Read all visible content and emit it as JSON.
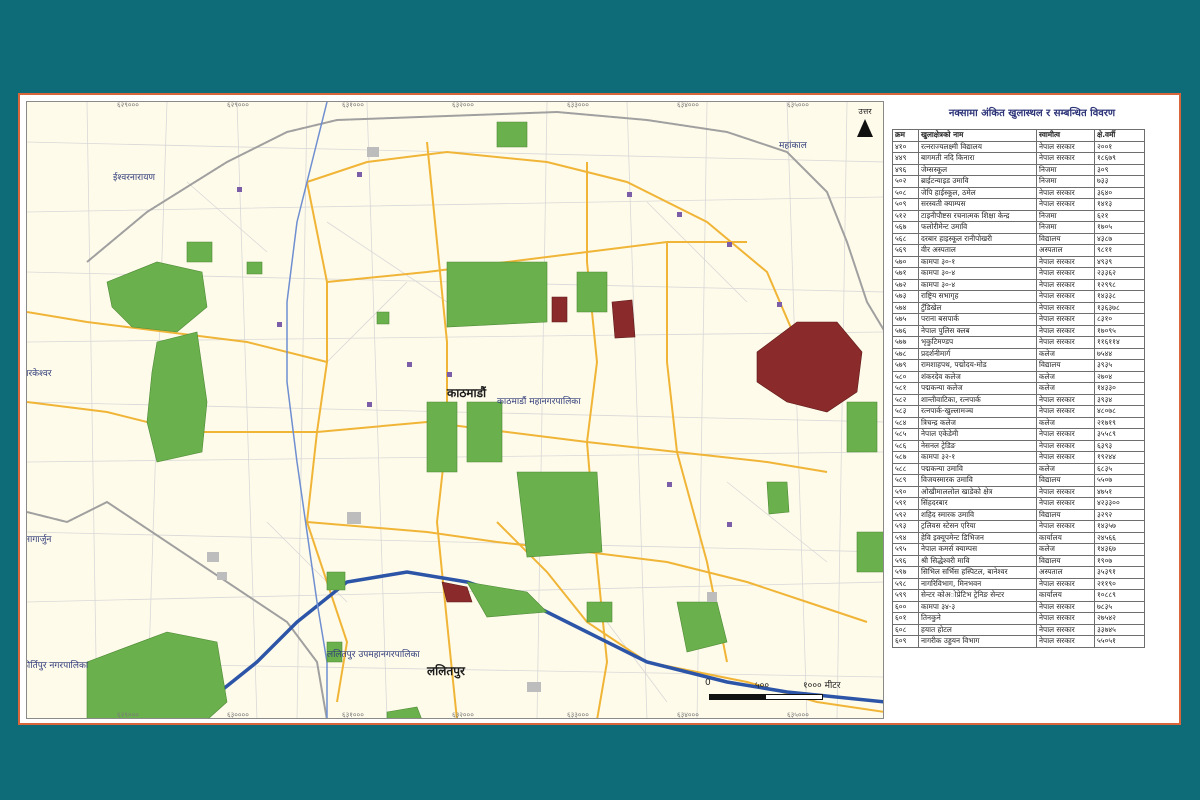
{
  "map": {
    "place_labels": [
      {
        "id": "kathmandu",
        "text": "काठमाडौं"
      },
      {
        "id": "kathmandu-metro",
        "text": "काठमाडौं महानगरपालिका"
      },
      {
        "id": "lalitpur",
        "text": "ललितपुर"
      },
      {
        "id": "lalitpur-metro",
        "text": "ललितपुर उपमहानगरपालिका"
      },
      {
        "id": "budhanilkantha",
        "text": "ईश्वरनारायण"
      },
      {
        "id": "mahankal",
        "text": "महांकाल"
      },
      {
        "id": "tarakeshwor",
        "text": "तारकेश्वर"
      },
      {
        "id": "kirtipur",
        "text": "कीर्तिपुर नगरपालिका"
      },
      {
        "id": "nagarjun",
        "text": "नागार्जुन"
      }
    ],
    "north_label": "उत्तर",
    "scale": {
      "zero": "0",
      "mid": "५००",
      "end": "१००० मीटर"
    },
    "grid_ticks_top": [
      "६२९०००",
      "६२९०००",
      "६३१०००",
      "६३२०००",
      "६३३०००",
      "६३४०००",
      "६३५०००"
    ],
    "grid_ticks_bottom": [
      "६२९०००",
      "६३००००",
      "६३१०००",
      "६३२०००",
      "६३३०००",
      "६३४०००",
      "६३५०००"
    ]
  },
  "table": {
    "title": "नक्सामा अंकित खुलास्थल र सम्बन्धित विवरण",
    "headers": [
      "क्रम",
      "खुलाक्षेत्रको नाम",
      "स्वामीत्व",
      "क्षे.वर्मी"
    ],
    "rows": [
      [
        "४१०",
        "रत्नराज्यलक्ष्मी विद्यालय",
        "नेपाल सरकार",
        "२००१"
      ],
      [
        "४४९",
        "बागमती नदि किनारा",
        "नेपाल सरकार",
        "१८६७९"
      ],
      [
        "४९६",
        "जेम्सस्कूल",
        "निजमा",
        "३०९"
      ],
      [
        "५०२",
        "ब्राईटन्याइड उमावि",
        "निजमा",
        "७३३"
      ],
      [
        "५०८",
        "जेपि हाईस्कूल, ठमेल",
        "नेपाल सरकार",
        "३६४०"
      ],
      [
        "५०९",
        "सरस्वती क्याम्पस",
        "नेपाल सरकार",
        "१४१३"
      ],
      [
        "५१२",
        "टाइनीपौष्टस रचनात्मक शिक्षा केन्द्र",
        "निजमा",
        "६२१"
      ],
      [
        "५६७",
        "फलोरीमेन्ट उमावि",
        "निजमा",
        "१७०५"
      ],
      [
        "५६८",
        "दरबार हाइस्कूल रानीपोखरी",
        "विद्यालय",
        "४३८७"
      ],
      [
        "५६९",
        "वीर अस्पताल",
        "अस्पताल",
        "९८११"
      ],
      [
        "५७०",
        "कामपा ३०-१",
        "नेपाल सरकार",
        "४९३९"
      ],
      [
        "५७१",
        "कामपा ३०-४",
        "नेपाल सरकार",
        "२३३६२"
      ],
      [
        "५७२",
        "कामपा ३०-४",
        "नेपाल सरकार",
        "१२९९८"
      ],
      [
        "५७३",
        "राष्ट्रिय सभागृह",
        "नेपाल सरकार",
        "१४३३८"
      ],
      [
        "५७४",
        "टुँडिखेल",
        "नेपाल सरकार",
        "१३६३७८"
      ],
      [
        "५७५",
        "पराना बसपार्क",
        "नेपाल सरकार",
        "८३१०"
      ],
      [
        "५७६",
        "नेपाल पुलिस क्लब",
        "नेपाल सरकार",
        "१७०९५"
      ],
      [
        "५७७",
        "भृकुटिमण्डप",
        "नेपाल सरकार",
        "११६११४"
      ],
      [
        "५७८",
        "प्रदर्शनीमार्ग",
        "कलेज",
        "७५४४"
      ],
      [
        "५७९",
        "रामशाहपथ, पद्मोदय-मोड",
        "विद्यालय",
        "३९३५"
      ],
      [
        "५८०",
        "शंकरदेव कलेज",
        "कलेज",
        "२७०४"
      ],
      [
        "५८१",
        "पद्मकन्या कलेज",
        "कलेज",
        "१४३३०"
      ],
      [
        "५८२",
        "शान्तीवाटिका, रत्नपार्क",
        "नेपाल सरकार",
        "३९३४"
      ],
      [
        "५८३",
        "रत्नपार्क-खुल्लामञ्च",
        "नेपाल सरकार",
        "४८०७८"
      ],
      [
        "५८४",
        "त्रिचन्द्र कलेज",
        "कलेज",
        "२१७१९"
      ],
      [
        "५८५",
        "नेपाल एकेडेमी",
        "नेपाल सरकार",
        "३५५८९"
      ],
      [
        "५८६",
        "नेसनल ट्रेडिङ",
        "नेपाल सरकार",
        "६३९३"
      ],
      [
        "५८७",
        "कामपा ३२-१",
        "नेपाल सरकार",
        "१९२४४"
      ],
      [
        "५८८",
        "पद्मकन्या उमावि",
        "कलेज",
        "६८३५"
      ],
      [
        "५८९",
        "विजयस्मारक उमावि",
        "विद्यालय",
        "५५०७"
      ],
      [
        "५९०",
        "ओखीमाललोल खाडेको क्षेत्र",
        "नेपाल सरकार",
        "४७५१"
      ],
      [
        "५९१",
        "सिंहदरबार",
        "नेपाल सरकार",
        "४२३३००"
      ],
      [
        "५९२",
        "शहिद स्मारक उमावि",
        "विद्यालय",
        "३२९२"
      ],
      [
        "५९३",
        "ट्रलिवस स्टेसन एरिया",
        "नेपाल सरकार",
        "१४३५७"
      ],
      [
        "५९४",
        "हेवि इक्यूपमेन्ट डिभिजन",
        "कार्यालय",
        "२४५६६"
      ],
      [
        "५९५",
        "नेपाल कमर्स क्याम्पस",
        "कलेज",
        "१४३६७"
      ],
      [
        "५९६",
        "श्री सिद्धेश्वरी मावि",
        "विद्यालय",
        "१९०७"
      ],
      [
        "५९७",
        "सिभिल सर्भिस हस्पिटल, बानेश्वर",
        "अस्पताल",
        "३५३९१"
      ],
      [
        "५९८",
        "नागरिविभाग, मिनभवन",
        "नेपाल सरकार",
        "२११९०"
      ],
      [
        "५९९",
        "सेन्टर कोअोप्रेटिभ ट्रेनिङ सेन्टर",
        "कार्यालय",
        "१०८८९"
      ],
      [
        "६००",
        "कामपा ३४-३",
        "नेपाल सरकार",
        "७८३५"
      ],
      [
        "६०१",
        "तिनकुने",
        "नेपाल सरकार",
        "२७५४२"
      ],
      [
        "६०८",
        "हयात होटल",
        "नेपाल सरकार",
        "३३७४५"
      ],
      [
        "६०९",
        "नागरीक उड्डयन विभाग",
        "नेपाल सरकार",
        "५५०५१"
      ]
    ]
  },
  "colors": {
    "background": "#0e6c78",
    "frame": "#d9663a",
    "map_base": "#fffbea",
    "open_space_green": "#6ab04c",
    "airport_red": "#8b2a2a",
    "road_major": "#f0b537",
    "road_minor": "#d4d4d4",
    "river": "#2c55a8",
    "boundary": "#9e9e9e",
    "label_blue": "#2f3b7a"
  }
}
